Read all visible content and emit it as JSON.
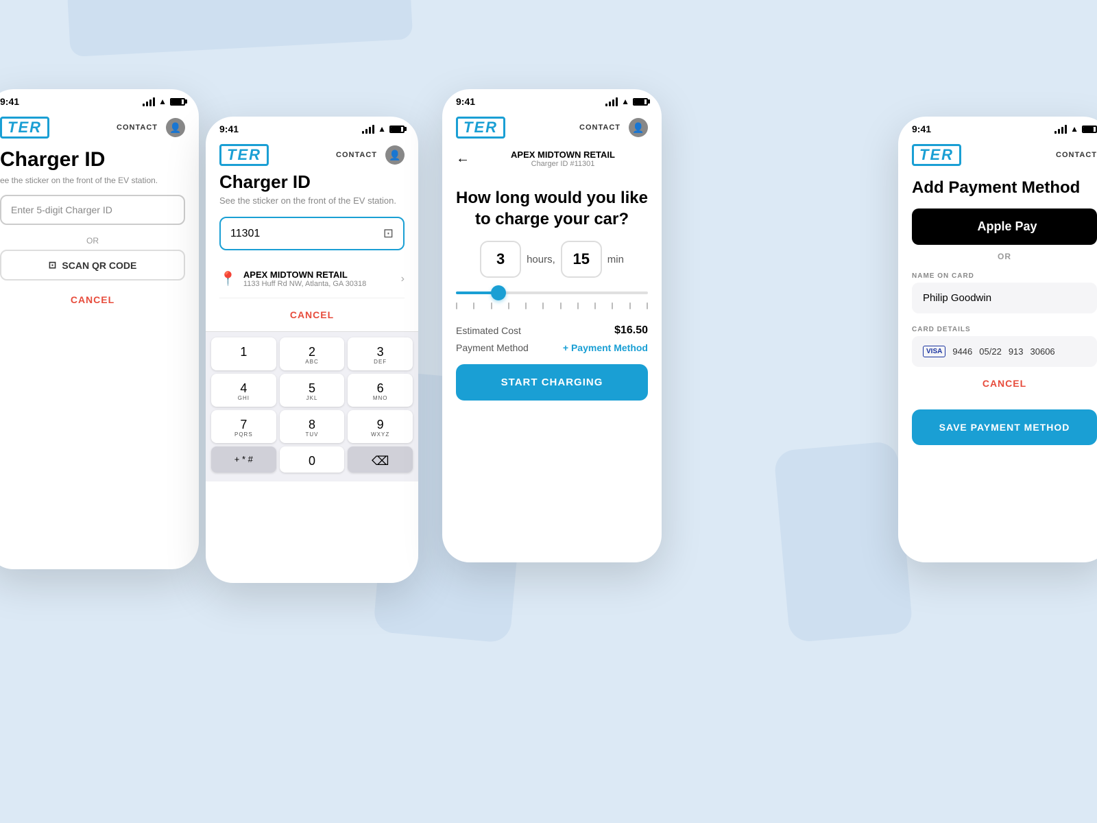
{
  "app": {
    "logo": "TER",
    "contact_label": "CONTACT",
    "time": "9:41"
  },
  "screen1": {
    "title": "Charger ID",
    "subtitle": "ee the sticker on the front of the EV station.",
    "input_placeholder": "Enter 5-digit Charger ID",
    "or_label": "OR",
    "scan_label": "SCAN QR CODE",
    "cancel_label": "CANCEL"
  },
  "screen2": {
    "title": "Charger ID",
    "subtitle": "See the sticker on the front of the EV station.",
    "input_value": "11301",
    "location_name": "APEX MIDTOWN RETAIL",
    "location_address": "1133 Huff Rd NW, Atlanta, GA 30318",
    "cancel_label": "CANCEL",
    "keys": [
      {
        "main": "1",
        "sub": ""
      },
      {
        "main": "2",
        "sub": "ABC"
      },
      {
        "main": "3",
        "sub": "DEF"
      },
      {
        "main": "4",
        "sub": "GHI"
      },
      {
        "main": "5",
        "sub": "JKL"
      },
      {
        "main": "6",
        "sub": "MNO"
      },
      {
        "main": "7",
        "sub": "PQRS"
      },
      {
        "main": "8",
        "sub": "TUV"
      },
      {
        "main": "9",
        "sub": "WXYZ"
      },
      {
        "main": "+ * #",
        "sub": ""
      },
      {
        "main": "0",
        "sub": ""
      },
      {
        "main": "⌫",
        "sub": ""
      }
    ]
  },
  "screen3": {
    "location_name": "APEX MIDTOWN RETAIL",
    "charger_id": "Charger ID #11301",
    "question": "How long would you like to charge your car?",
    "hours_value": "3",
    "hours_label": "hours,",
    "min_value": "15",
    "min_label": "min",
    "slider_percent": 22,
    "estimated_cost_label": "Estimated Cost",
    "estimated_cost_value": "$16.50",
    "payment_method_label": "Payment Method",
    "payment_method_link": "+ Payment Method",
    "start_btn_label": "START CHARGING"
  },
  "screen4": {
    "title": "Add Payment Method",
    "apple_pay_label": "Apple Pay",
    "or_label": "OR",
    "name_label": "NAME ON CARD",
    "name_value": "Philip Goodwin",
    "card_label": "CARD DETAILS",
    "card_type": "VISA",
    "card_last4": "9446",
    "card_expiry": "05/22",
    "card_cvv": "913",
    "card_zip": "30606",
    "cancel_label": "CANCEL",
    "save_btn_label": "SAVE PAYMENT METHOD"
  },
  "background": {
    "color": "#dce9f5",
    "blob_color": "#c5d8ed"
  }
}
